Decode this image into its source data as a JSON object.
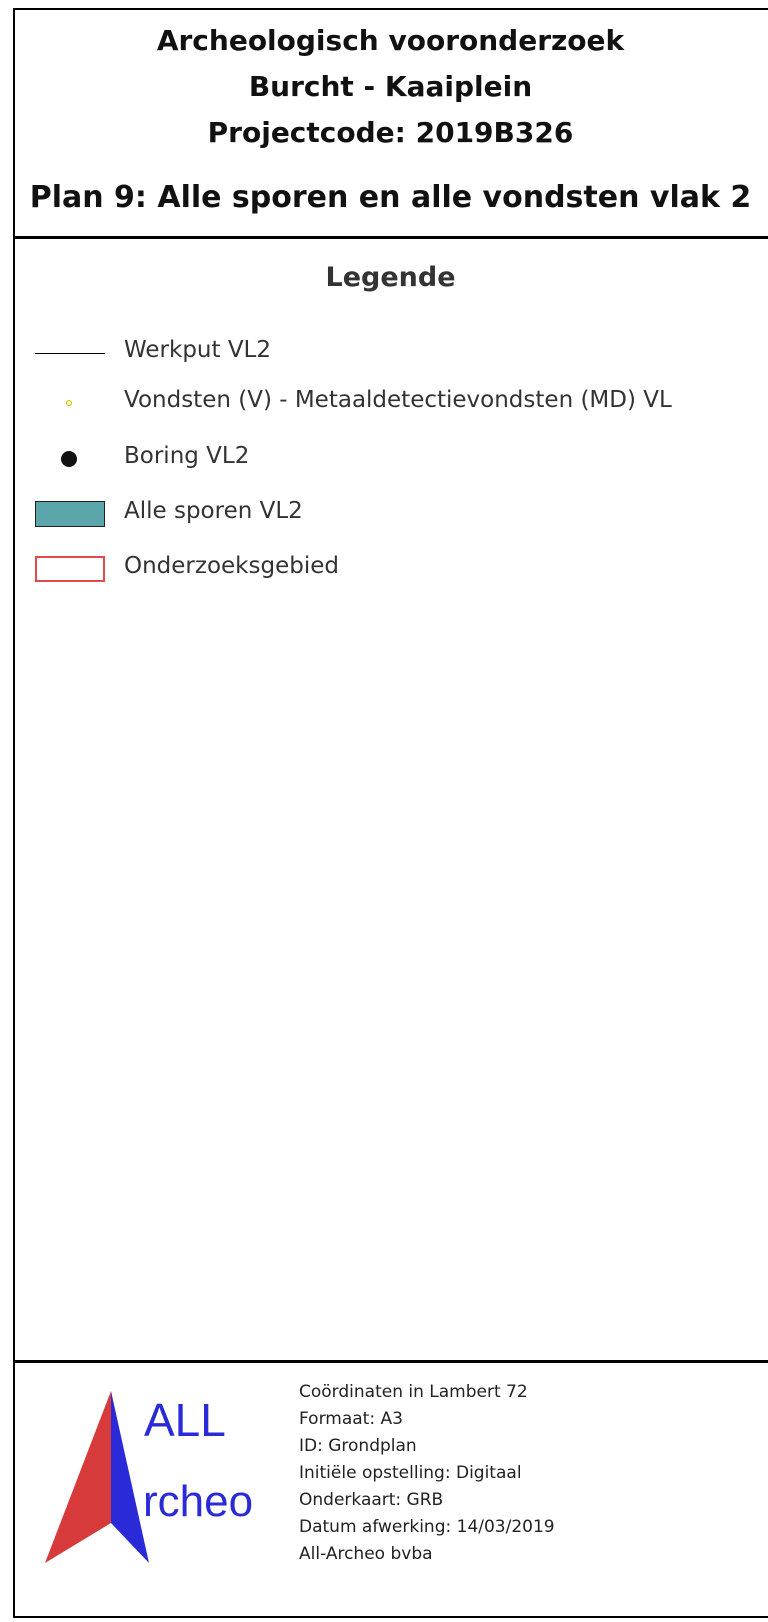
{
  "header": {
    "title_line1": "Archeologisch vooronderzoek",
    "title_line2": "Burcht - Kaaiplein",
    "title_line3": "Projectcode: 2019B326",
    "plan_title": "Plan 9: Alle sporen en alle vondsten vlak 2"
  },
  "legend": {
    "title": "Legende",
    "items": [
      {
        "label": "Werkput VL2",
        "symbol": "line"
      },
      {
        "label": "Vondsten (V) - Metaaldetectievondsten (MD) VL",
        "symbol": "small-yellow-dot"
      },
      {
        "label": "Boring VL2",
        "symbol": "black-dot"
      },
      {
        "label": "Alle sporen VL2",
        "symbol": "teal-filled-rectangle"
      },
      {
        "label": "Onderzoeksgebied",
        "symbol": "red-outline-rectangle"
      }
    ],
    "colors": {
      "sporen_fill": "#5ba6aa",
      "onderzoeksgebied_outline": "#e04a4a",
      "vondsten_dot": "#c8c800"
    }
  },
  "footer": {
    "logo": {
      "text_top": "ALL",
      "text_bottom": "rcheo",
      "colors": {
        "left": "#d63a3a",
        "right": "#2a2ad8"
      }
    },
    "meta": [
      "Coördinaten in Lambert 72",
      "Formaat: A3",
      "ID: Grondplan",
      "Initiële opstelling: Digitaal",
      "Onderkaart: GRB",
      "Datum afwerking: 14/03/2019",
      "All-Archeo bvba"
    ]
  }
}
